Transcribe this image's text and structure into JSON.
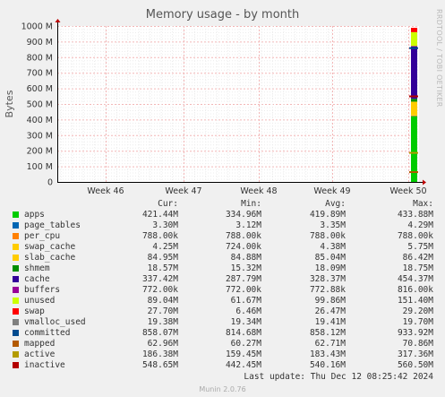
{
  "chart_data": {
    "type": "area",
    "title": "Memory usage - by month",
    "ylabel": "Bytes",
    "side_label": "RRDTOOL / TOBI OETIKER",
    "ylim": [
      0,
      1000
    ],
    "y_unit": "M",
    "y_ticks": [
      0,
      100,
      200,
      300,
      400,
      500,
      600,
      700,
      800,
      900,
      1000
    ],
    "y_tick_labels": [
      "0",
      "100 M",
      "200 M",
      "300 M",
      "400 M",
      "500 M",
      "600 M",
      "700 M",
      "800 M",
      "900 M",
      "1000 M"
    ],
    "x_tick_labels": [
      "Week 46",
      "Week 47",
      "Week 48",
      "Week 49",
      "Week 50"
    ],
    "grid": true,
    "legend_position": "bottom",
    "columns": [
      "Cur:",
      "Min:",
      "Avg:",
      "Max:"
    ],
    "series": [
      {
        "name": "apps",
        "color": "#00cc00",
        "cur": "421.44M",
        "min": "334.96M",
        "avg": "419.89M",
        "max": "433.88M",
        "value_mb": 421.44
      },
      {
        "name": "page_tables",
        "color": "#0066b3",
        "cur": "3.30M",
        "min": "3.12M",
        "avg": "3.35M",
        "max": "4.29M",
        "value_mb": 3.3
      },
      {
        "name": "per_cpu",
        "color": "#ff8000",
        "cur": "788.00k",
        "min": "788.00k",
        "avg": "788.00k",
        "max": "788.00k",
        "value_mb": 0.788
      },
      {
        "name": "swap_cache",
        "color": "#ffcc00",
        "cur": "4.25M",
        "min": "724.00k",
        "avg": "4.38M",
        "max": "5.75M",
        "value_mb": 4.25
      },
      {
        "name": "slab_cache",
        "color": "#ffcc00",
        "cur": "84.95M",
        "min": "84.88M",
        "avg": "85.04M",
        "max": "86.42M",
        "value_mb": 84.95
      },
      {
        "name": "shmem",
        "color": "#008f00",
        "cur": "18.57M",
        "min": "15.32M",
        "avg": "18.09M",
        "max": "18.75M",
        "value_mb": 18.57
      },
      {
        "name": "cache",
        "color": "#330099",
        "cur": "337.42M",
        "min": "287.79M",
        "avg": "328.37M",
        "max": "454.37M",
        "value_mb": 337.42
      },
      {
        "name": "buffers",
        "color": "#990099",
        "cur": "772.00k",
        "min": "772.00k",
        "avg": "772.88k",
        "max": "816.00k",
        "value_mb": 0.772
      },
      {
        "name": "unused",
        "color": "#ccff00",
        "cur": "89.04M",
        "min": "61.67M",
        "avg": "99.86M",
        "max": "151.40M",
        "value_mb": 89.04
      },
      {
        "name": "swap",
        "color": "#ff0000",
        "cur": "27.70M",
        "min": "6.46M",
        "avg": "26.47M",
        "max": "29.20M",
        "value_mb": 27.7
      },
      {
        "name": "vmalloc_used",
        "color": "#808080",
        "cur": "19.38M",
        "min": "19.34M",
        "avg": "19.41M",
        "max": "19.70M"
      },
      {
        "name": "committed",
        "color": "#004b8f",
        "cur": "858.07M",
        "min": "814.68M",
        "avg": "858.12M",
        "max": "933.92M"
      },
      {
        "name": "mapped",
        "color": "#b35a00",
        "cur": "62.96M",
        "min": "60.27M",
        "avg": "62.71M",
        "max": "70.86M"
      },
      {
        "name": "active",
        "color": "#b39b00",
        "cur": "186.38M",
        "min": "159.45M",
        "avg": "183.43M",
        "max": "317.36M"
      },
      {
        "name": "inactive",
        "color": "#b30000",
        "cur": "548.65M",
        "min": "442.45M",
        "avg": "540.16M",
        "max": "560.50M"
      }
    ]
  },
  "footer": {
    "last_update": "Last update: Thu Dec 12 08:25:42 2024",
    "version": "Munin 2.0.76"
  }
}
